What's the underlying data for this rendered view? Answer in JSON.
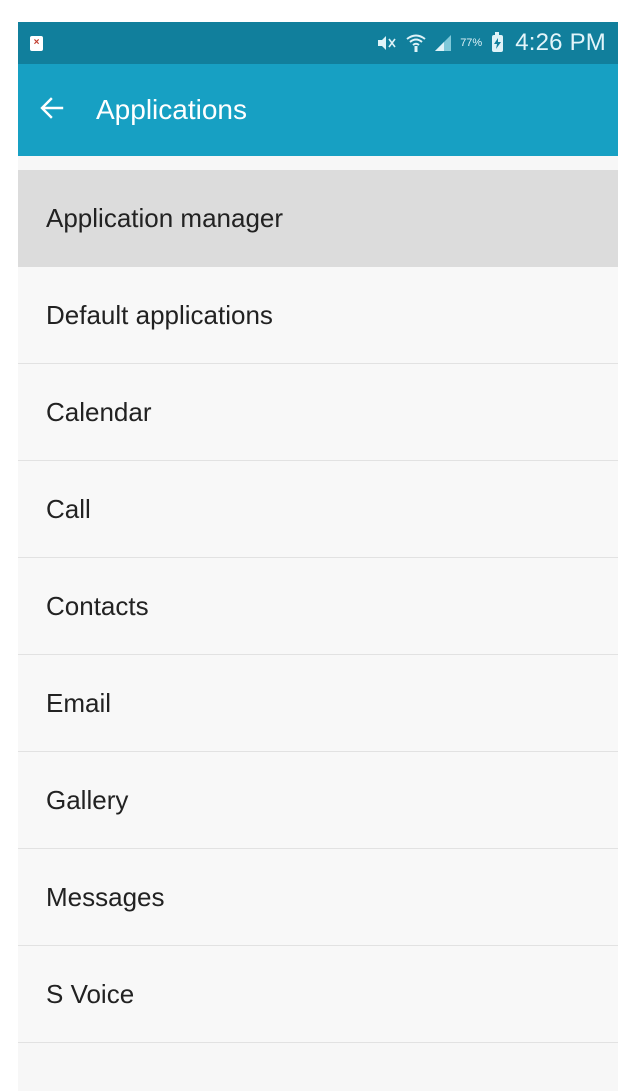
{
  "status_bar": {
    "notification_icon": "error-notification-icon",
    "battery_percent": "77%",
    "time": "4:26 PM",
    "icons": [
      "mute-icon",
      "wifi-icon",
      "signal-icon",
      "battery-charging-icon"
    ],
    "colors": {
      "background": "#117f9c"
    }
  },
  "app_bar": {
    "back_icon": "back-arrow-icon",
    "title": "Applications",
    "colors": {
      "background": "#17a0c3",
      "text": "#ffffff"
    }
  },
  "list": {
    "items": [
      {
        "label": "Application manager",
        "selected": true
      },
      {
        "label": "Default applications"
      },
      {
        "label": "Calendar"
      },
      {
        "label": "Call"
      },
      {
        "label": "Contacts"
      },
      {
        "label": "Email"
      },
      {
        "label": "Gallery"
      },
      {
        "label": "Messages"
      },
      {
        "label": "S Voice"
      }
    ],
    "colors": {
      "selected_background": "#dcdcdc",
      "background": "#f8f8f8"
    }
  }
}
